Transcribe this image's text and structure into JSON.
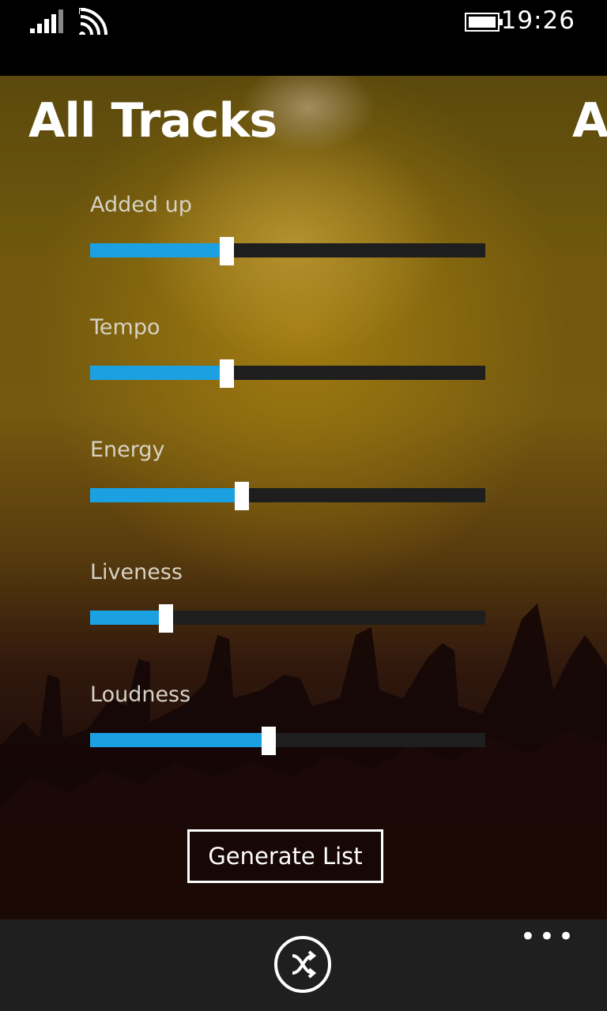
{
  "status_bar": {
    "time": "19:26",
    "icons": [
      "signal-icon",
      "wifi-icon",
      "battery-icon"
    ]
  },
  "pivot": {
    "title": "All Tracks",
    "next_title_peek": "A"
  },
  "sliders": [
    {
      "label": "Added up",
      "value": 0.34
    },
    {
      "label": "Tempo",
      "value": 0.34
    },
    {
      "label": "Energy",
      "value": 0.38
    },
    {
      "label": "Liveness",
      "value": 0.18
    },
    {
      "label": "Loudness",
      "value": 0.45
    }
  ],
  "generate_button": {
    "label": "Generate List"
  },
  "app_bar": {
    "primary_icon": "shuffle-icon",
    "more_label": "•••"
  },
  "colors": {
    "accent": "#1ba1e2",
    "track": "#1e1e1e",
    "app_bar": "#1f1f1f"
  }
}
